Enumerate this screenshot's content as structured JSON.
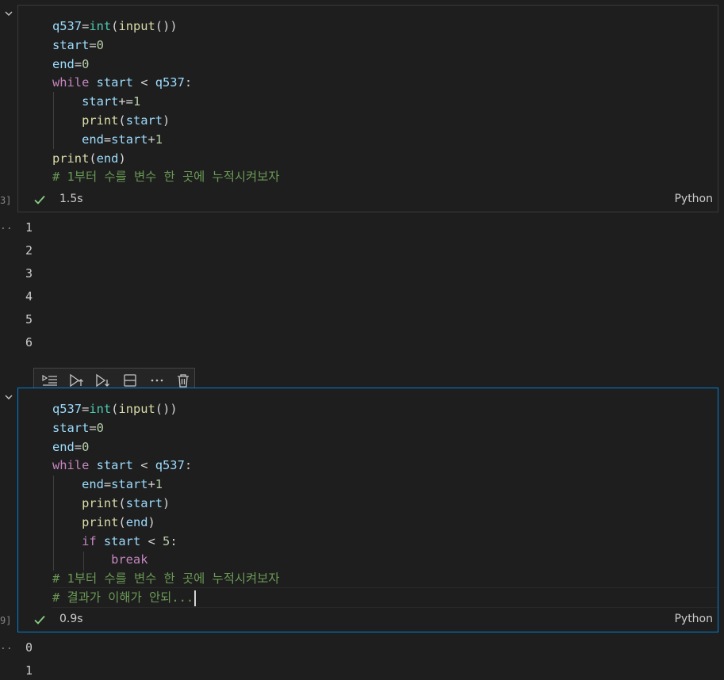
{
  "cell1": {
    "exec_count": "3]",
    "lines": [
      [
        [
          "var",
          "q537"
        ],
        [
          "op",
          "="
        ],
        [
          "cls",
          "int"
        ],
        [
          "punc",
          "("
        ],
        [
          "fn",
          "input"
        ],
        [
          "punc",
          "())"
        ]
      ],
      [
        [
          "var",
          "start"
        ],
        [
          "op",
          "="
        ],
        [
          "num",
          "0"
        ]
      ],
      [
        [
          "var",
          "end"
        ],
        [
          "op",
          "="
        ],
        [
          "num",
          "0"
        ]
      ],
      [
        [
          "kw-ctrl",
          "while"
        ],
        [
          "var",
          " start "
        ],
        [
          "op",
          "<"
        ],
        [
          "var",
          " q537"
        ],
        [
          "punc",
          ":"
        ]
      ],
      [
        [
          "var",
          "    start"
        ],
        [
          "op",
          "+="
        ],
        [
          "num",
          "1"
        ]
      ],
      [
        [
          "fn",
          "    print"
        ],
        [
          "punc",
          "("
        ],
        [
          "var",
          "start"
        ],
        [
          "punc",
          ")"
        ]
      ],
      [
        [
          "var",
          "    end"
        ],
        [
          "op",
          "="
        ],
        [
          "var",
          "start"
        ],
        [
          "op",
          "+"
        ],
        [
          "num",
          "1"
        ]
      ],
      [
        [
          "fn",
          "print"
        ],
        [
          "punc",
          "("
        ],
        [
          "var",
          "end"
        ],
        [
          "punc",
          ")"
        ]
      ],
      [
        [
          "comment",
          "# 1부터 수를 변수 한 곳에 누적시켜보자"
        ]
      ]
    ],
    "duration": "1.5s",
    "language": "Python"
  },
  "output1": {
    "marker": "..",
    "lines": [
      "1",
      "2",
      "3",
      "4",
      "5",
      "6"
    ]
  },
  "toolbar": {
    "icons": [
      "execute-above-icon",
      "run-above-icon",
      "run-below-icon",
      "split-cell-icon",
      "more-icon",
      "delete-icon"
    ]
  },
  "cell2": {
    "exec_count": "9]",
    "lines": [
      [
        [
          "var",
          "q537"
        ],
        [
          "op",
          "="
        ],
        [
          "cls",
          "int"
        ],
        [
          "punc",
          "("
        ],
        [
          "fn",
          "input"
        ],
        [
          "punc",
          "())"
        ]
      ],
      [
        [
          "var",
          "start"
        ],
        [
          "op",
          "="
        ],
        [
          "num",
          "0"
        ]
      ],
      [
        [
          "var",
          "end"
        ],
        [
          "op",
          "="
        ],
        [
          "num",
          "0"
        ]
      ],
      [
        [
          "kw-ctrl",
          "while"
        ],
        [
          "var",
          " start "
        ],
        [
          "op",
          "<"
        ],
        [
          "var",
          " q537"
        ],
        [
          "punc",
          ":"
        ]
      ],
      [
        [
          "var",
          "    end"
        ],
        [
          "op",
          "="
        ],
        [
          "var",
          "start"
        ],
        [
          "op",
          "+"
        ],
        [
          "num",
          "1"
        ]
      ],
      [
        [
          "fn",
          "    print"
        ],
        [
          "punc",
          "("
        ],
        [
          "var",
          "start"
        ],
        [
          "punc",
          ")"
        ]
      ],
      [
        [
          "fn",
          "    print"
        ],
        [
          "punc",
          "("
        ],
        [
          "var",
          "end"
        ],
        [
          "punc",
          ")"
        ]
      ],
      [
        [
          "kw-ctrl",
          "    if"
        ],
        [
          "var",
          " start "
        ],
        [
          "op",
          "<"
        ],
        [
          "num",
          " 5"
        ],
        [
          "punc",
          ":"
        ]
      ],
      [
        [
          "kw-ctrl",
          "        break"
        ]
      ],
      [
        [
          "comment",
          "# 1부터 수를 변수 한 곳에 누적시켜보자"
        ]
      ],
      [
        [
          "comment",
          "# 결과가 이해가 안되..."
        ]
      ]
    ],
    "duration": "0.9s",
    "language": "Python"
  },
  "output2": {
    "marker": "..",
    "lines": [
      "0",
      "1"
    ]
  },
  "colors": {
    "background": "#1e1e1e",
    "focus_border": "#007fd4",
    "success": "#89d185",
    "keyword": "#c586c0",
    "function": "#dcdcaa",
    "variable": "#9cdcfe",
    "number": "#b5cea8",
    "comment": "#6a9955",
    "class": "#4ec9b0"
  }
}
